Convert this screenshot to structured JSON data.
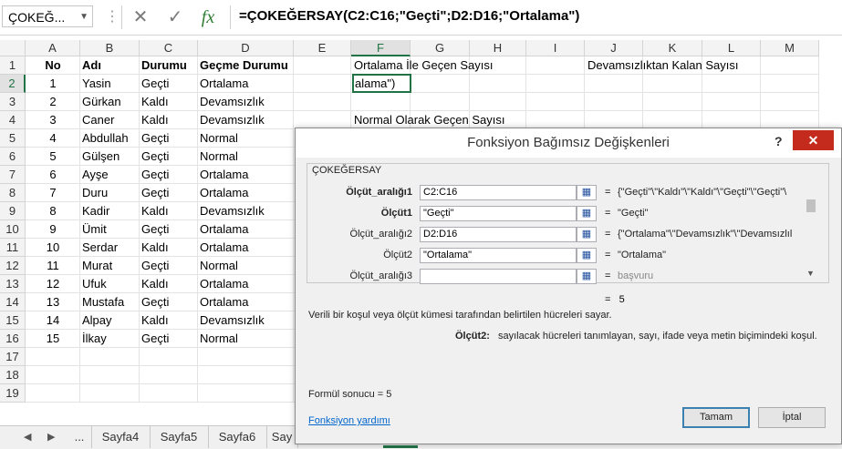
{
  "formula_bar": {
    "name_box": "ÇOKEĞ...",
    "cancel_icon": "✕",
    "enter_icon": "✓",
    "fx_label": "fx",
    "formula": "=ÇOKEĞERSAY(C2:C16;\"Geçti\";D2:D16;\"Ortalama\")"
  },
  "columns": [
    "A",
    "B",
    "C",
    "D",
    "E",
    "F",
    "G",
    "H",
    "I",
    "J",
    "K",
    "L",
    "M"
  ],
  "rows": [
    "1",
    "2",
    "3",
    "4",
    "5",
    "6",
    "7",
    "8",
    "9",
    "10",
    "11",
    "12",
    "13",
    "14",
    "15",
    "16",
    "17",
    "18",
    "19"
  ],
  "headers": {
    "no": "No",
    "name": "Adı",
    "status": "Durumu",
    "pass_status": "Geçme Durumu"
  },
  "table": [
    [
      "1",
      "Yasin",
      "Geçti",
      "Ortalama"
    ],
    [
      "2",
      "Gürkan",
      "Kaldı",
      "Devamsızlık"
    ],
    [
      "3",
      "Caner",
      "Kaldı",
      "Devamsızlık"
    ],
    [
      "4",
      "Abdullah",
      "Geçti",
      "Normal"
    ],
    [
      "5",
      "Gülşen",
      "Geçti",
      "Normal"
    ],
    [
      "6",
      "Ayşe",
      "Geçti",
      "Ortalama"
    ],
    [
      "7",
      "Duru",
      "Geçti",
      "Ortalama"
    ],
    [
      "8",
      "Kadir",
      "Kaldı",
      "Devamsızlık"
    ],
    [
      "9",
      "Ümit",
      "Geçti",
      "Ortalama"
    ],
    [
      "10",
      "Serdar",
      "Kaldı",
      "Ortalama"
    ],
    [
      "11",
      "Murat",
      "Geçti",
      "Normal"
    ],
    [
      "12",
      "Ufuk",
      "Kaldı",
      "Ortalama"
    ],
    [
      "13",
      "Mustafa",
      "Geçti",
      "Ortalama"
    ],
    [
      "14",
      "Alpay",
      "Kaldı",
      "Devamsızlık"
    ],
    [
      "15",
      "İlkay",
      "Geçti",
      "Normal"
    ]
  ],
  "side_labels": {
    "f1": "Ortalama İle Geçen Sayısı",
    "j1": "Devamsızlıktan Kalan Sayısı",
    "f4": "Normal Olarak Geçen Sayısı",
    "f2_editing": "alama\")"
  },
  "sheet_tabs": {
    "ellipsis": "...",
    "tabs": [
      "Sayfa4",
      "Sayfa5",
      "Sayfa6",
      "Say"
    ]
  },
  "dialog": {
    "title": "Fonksiyon Bağımsız Değişkenleri",
    "help_icon": "?",
    "close_icon": "✕",
    "function_name": "ÇOKEĞERSAY",
    "args": [
      {
        "label": "Ölçüt_aralığı1",
        "value": "C2:C16",
        "result": "{\"Geçti\"\\\"Kaldı\"\\\"Kaldı\"\\\"Geçti\"\\\"Geçti\"\\"
      },
      {
        "label": "Ölçüt1",
        "value": "\"Geçti\"",
        "result": "\"Geçti\""
      },
      {
        "label": "Ölçüt_aralığı2",
        "value": "D2:D16",
        "result": "{\"Ortalama\"\\\"Devamsızlık\"\\\"Devamsızlıl"
      },
      {
        "label": "Ölçüt2",
        "value": "\"Ortalama\"",
        "result": "\"Ortalama\""
      },
      {
        "label": "Ölçüt_aralığı3",
        "value": "",
        "result": "başvuru"
      }
    ],
    "equals": "=",
    "result_value": "5",
    "description": "Verili bir koşul veya ölçüt kümesi tarafından belirtilen hücreleri sayar.",
    "arg_desc_label": "Ölçüt2:",
    "arg_desc": "sayılacak hücreleri tanımlayan, sayı, ifade veya metin biçimindeki koşul.",
    "formula_result": "Formül sonucu =    5",
    "help_link": "Fonksiyon yardımı",
    "ok_label": "Tamam",
    "cancel_label": "İptal"
  }
}
